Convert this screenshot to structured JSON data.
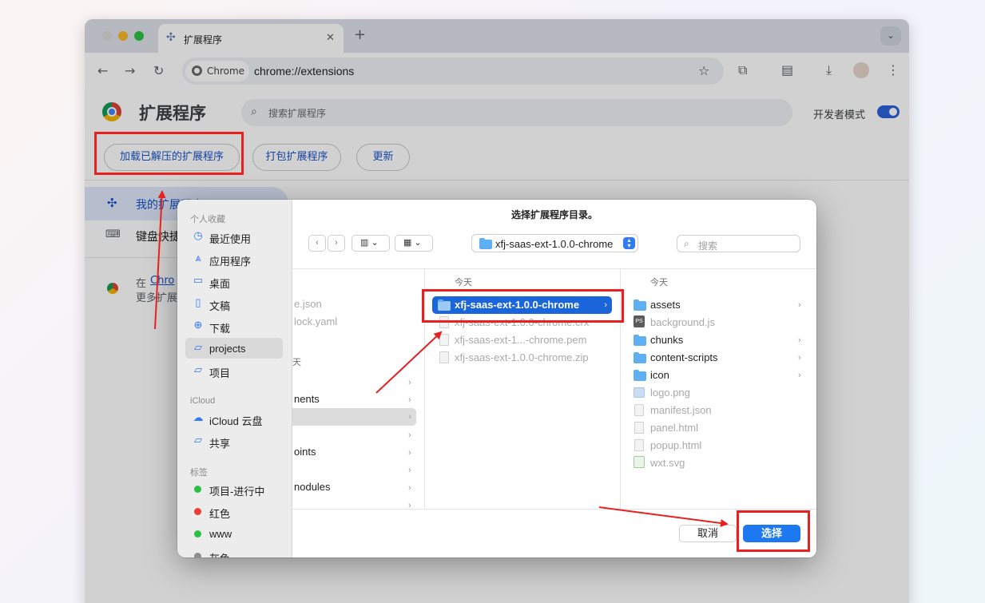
{
  "browser": {
    "tab_title": "扩展程序",
    "new_tab_symbol": "+",
    "omnibox_chip": "Chrome",
    "url": "chrome://extensions"
  },
  "extensions_page": {
    "title": "扩展程序",
    "search_placeholder": "搜索扩展程序",
    "dev_mode_label": "开发者模式",
    "dev_mode_on": true,
    "buttons": {
      "load_unpacked": "加载已解压的扩展程序",
      "pack": "打包扩展程序",
      "update": "更新"
    },
    "sidebar": {
      "my_extensions": "我的扩展程序",
      "shortcuts": "键盘快捷",
      "promo_prefix": "在",
      "promo_link": "Chro",
      "promo_line2": "更多扩展"
    }
  },
  "dialog": {
    "title": "选择扩展程序目录。",
    "path": "xfj-saas-ext-1.0.0-chrome",
    "search_placeholder": "搜索",
    "cancel": "取消",
    "choose": "选择",
    "favorites": {
      "heading": "个人收藏",
      "items": [
        {
          "label": "最近使用",
          "icon": "clock-icon"
        },
        {
          "label": "应用程序",
          "icon": "apps-icon"
        },
        {
          "label": "桌面",
          "icon": "desktop-icon"
        },
        {
          "label": "文稿",
          "icon": "document-icon"
        },
        {
          "label": "下载",
          "icon": "download-icon"
        },
        {
          "label": "projects",
          "icon": "folder-icon"
        },
        {
          "label": "项目",
          "icon": "folder-icon"
        }
      ]
    },
    "icloud": {
      "heading": "iCloud",
      "items": [
        {
          "label": "iCloud 云盘",
          "icon": "cloud-icon"
        },
        {
          "label": "共享",
          "icon": "shared-folder-icon"
        }
      ]
    },
    "tags": {
      "heading": "标签",
      "items": [
        {
          "label": "项目-进行中",
          "color": "#2dbe47"
        },
        {
          "label": "红色",
          "color": "#ee3b34"
        },
        {
          "label": "www",
          "color": "#2dbe47"
        },
        {
          "label": "灰色",
          "color": "#8e8e8e"
        }
      ]
    },
    "column1": {
      "rows": [
        "e.json",
        "lock.yaml",
        "",
        "天",
        "nents",
        "",
        "",
        "oints",
        "",
        "nodules",
        ""
      ]
    },
    "column2": {
      "heading": "今天",
      "rows": [
        "xfj-saas-ext-1.0.0-chrome",
        "xfj-saas-ext-1.0.0-chrome.crx",
        "xfj-saas-ext-1...-chrome.pem",
        "xfj-saas-ext-1.0.0-chrome.zip"
      ]
    },
    "column3": {
      "heading": "今天",
      "rows": [
        "assets",
        "background.js",
        "chunks",
        "content-scripts",
        "icon",
        "logo.png",
        "manifest.json",
        "panel.html",
        "popup.html",
        "wxt.svg"
      ]
    }
  }
}
